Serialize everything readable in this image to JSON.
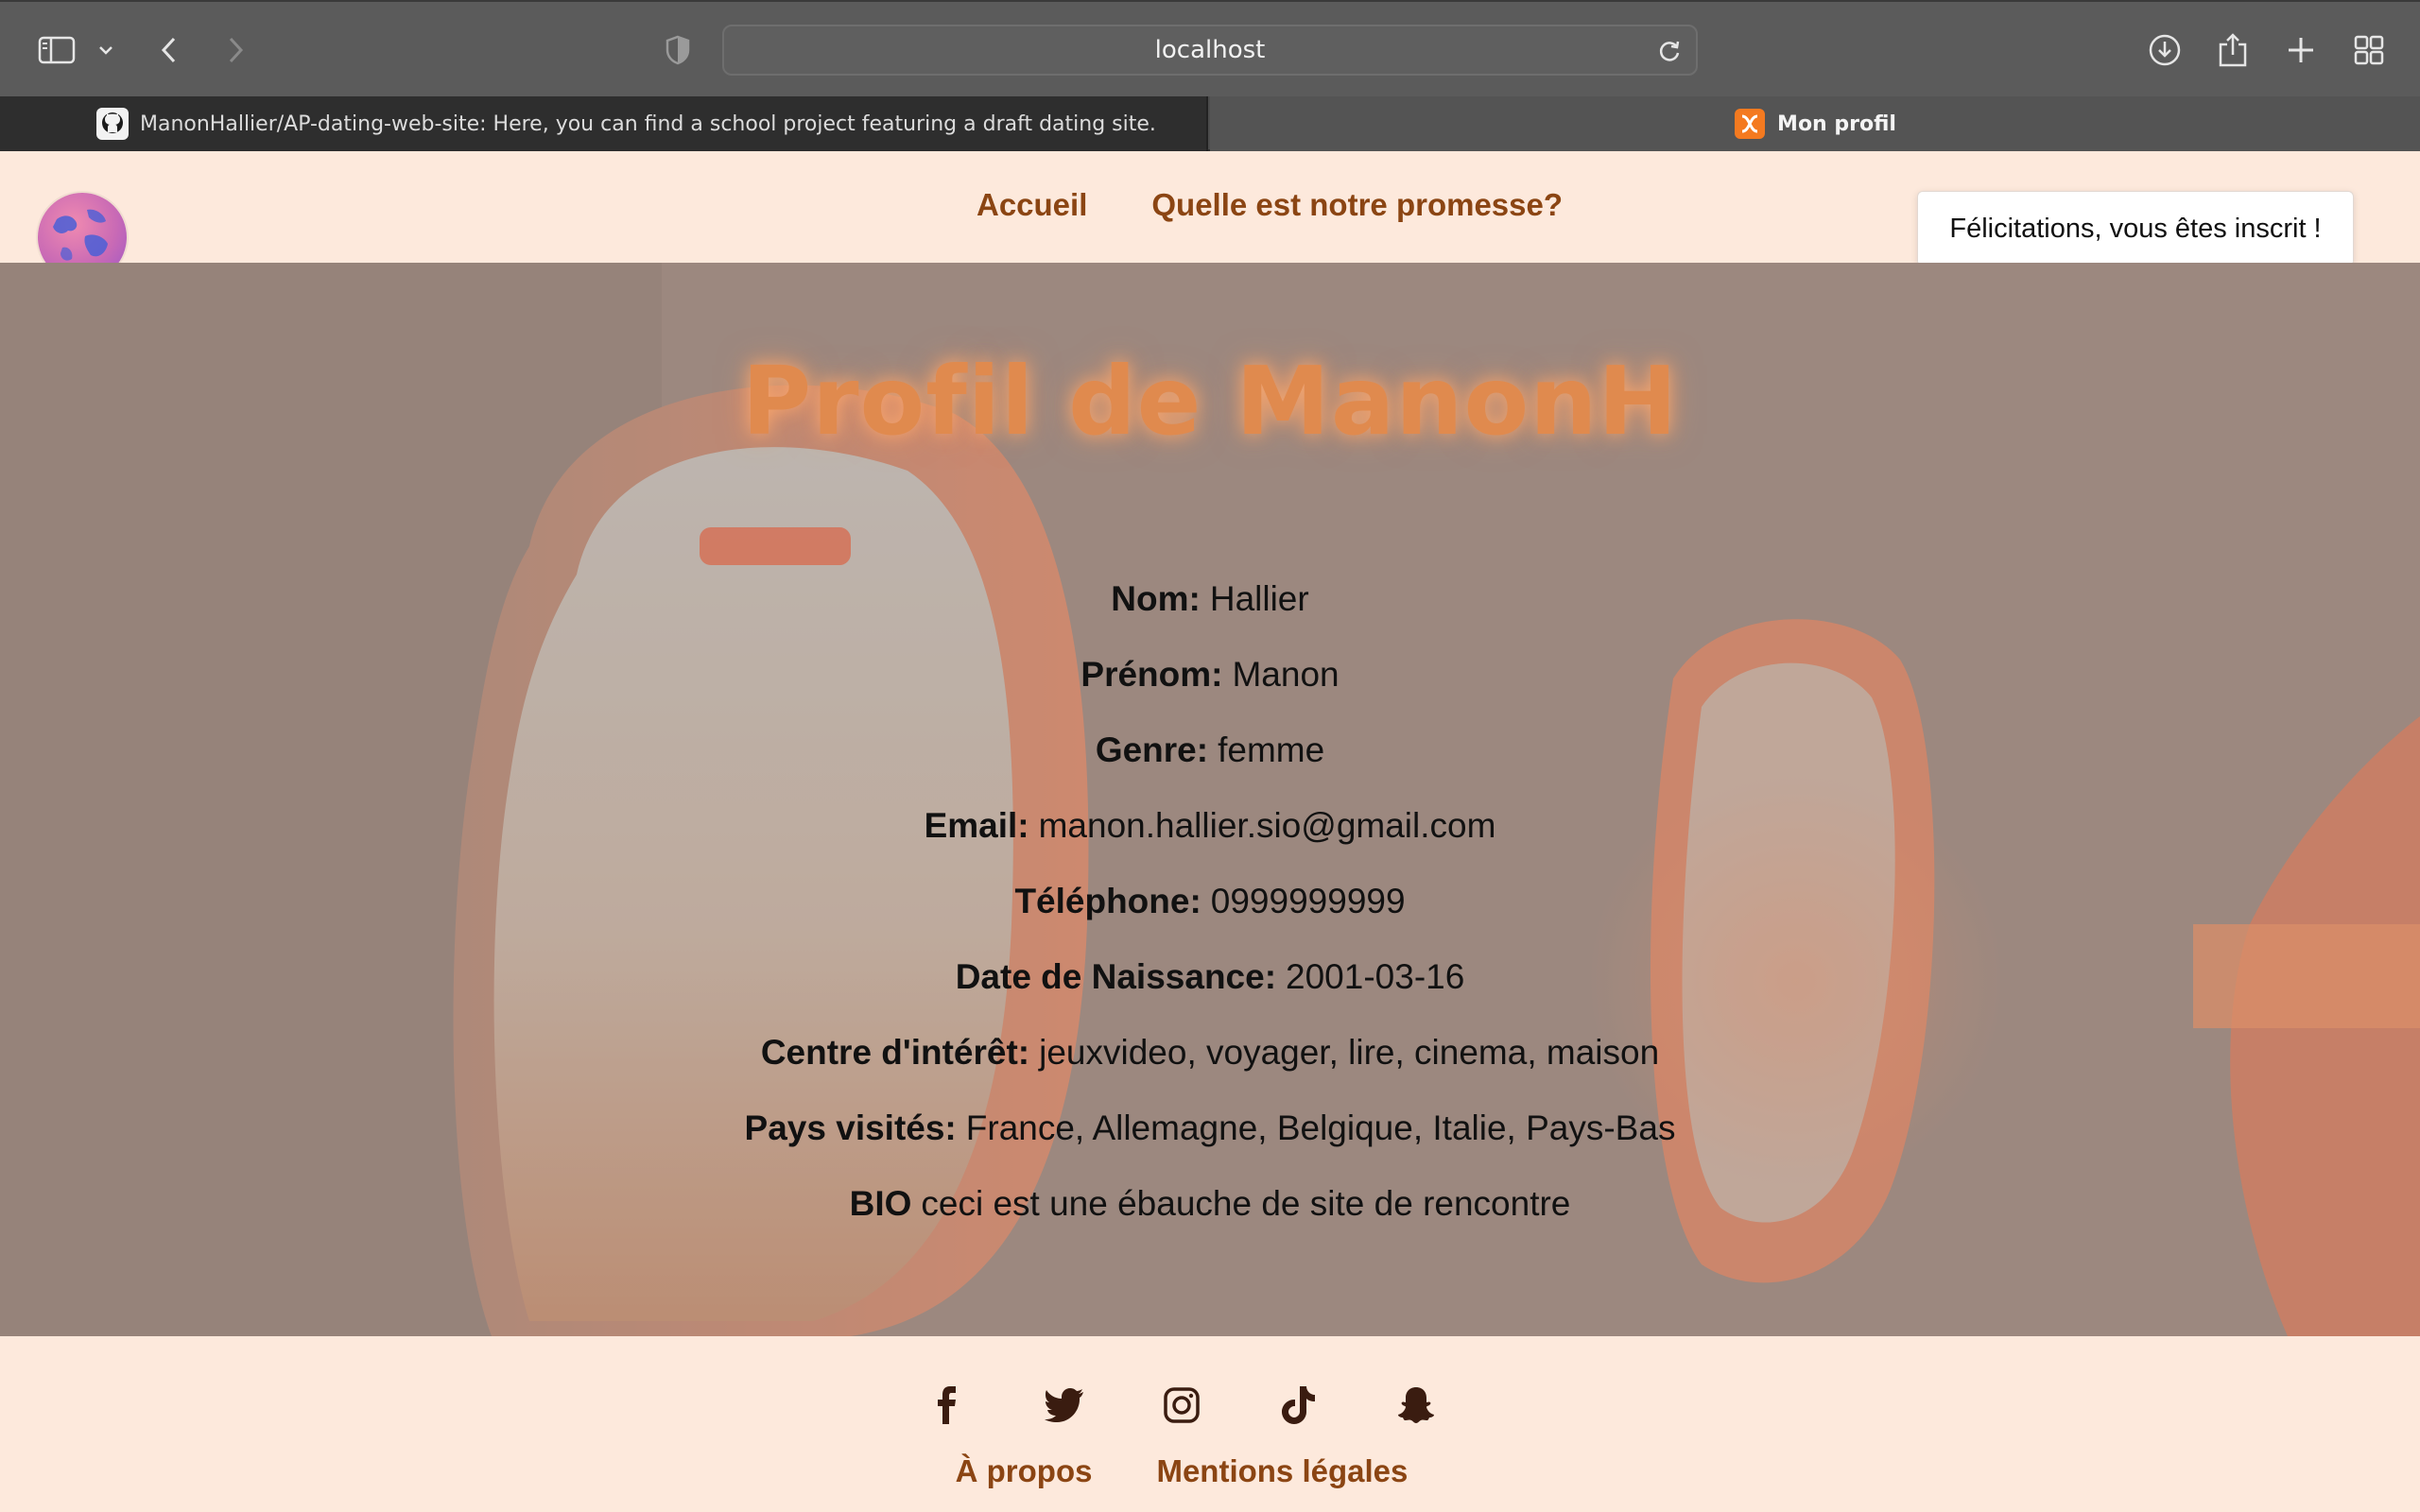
{
  "browser": {
    "url": "localhost",
    "tabs": [
      {
        "title": "ManonHallier/AP-dating-web-site: Here, you can find a school project featuring a draft dating site.",
        "favicon": "github-icon",
        "active": false
      },
      {
        "title": "Mon profil",
        "favicon": "xampp-icon",
        "active": true
      }
    ]
  },
  "header": {
    "nav": [
      "Accueil",
      "Quelle est notre promesse?"
    ],
    "toast": "Félicitations, vous êtes inscrit !"
  },
  "profile": {
    "title": "Profil de ManonH",
    "fields": [
      {
        "label": "Nom:",
        "value": "Hallier"
      },
      {
        "label": "Prénom:",
        "value": "Manon"
      },
      {
        "label": "Genre:",
        "value": "femme"
      },
      {
        "label": "Email:",
        "value": "manon.hallier.sio@gmail.com"
      },
      {
        "label": "Téléphone:",
        "value": "0999999999"
      },
      {
        "label": "Date de Naissance:",
        "value": "2001-03-16"
      },
      {
        "label": "Centre d'intérêt:",
        "value": "jeuxvideo, voyager, lire, cinema, maison"
      },
      {
        "label": "Pays visités:",
        "value": "France, Allemagne, Belgique, Italie, Pays-Bas"
      },
      {
        "label": "BIO",
        "value": "ceci est une ébauche de site de rencontre"
      }
    ]
  },
  "footer": {
    "socials": [
      "facebook-icon",
      "twitter-icon",
      "instagram-icon",
      "tiktok-icon",
      "snapchat-icon"
    ],
    "links": [
      "À propos",
      "Mentions légales"
    ]
  },
  "colors": {
    "accent": "#8b4513",
    "page_bg": "#fde9dc",
    "title_orange": "#e08a4e"
  }
}
